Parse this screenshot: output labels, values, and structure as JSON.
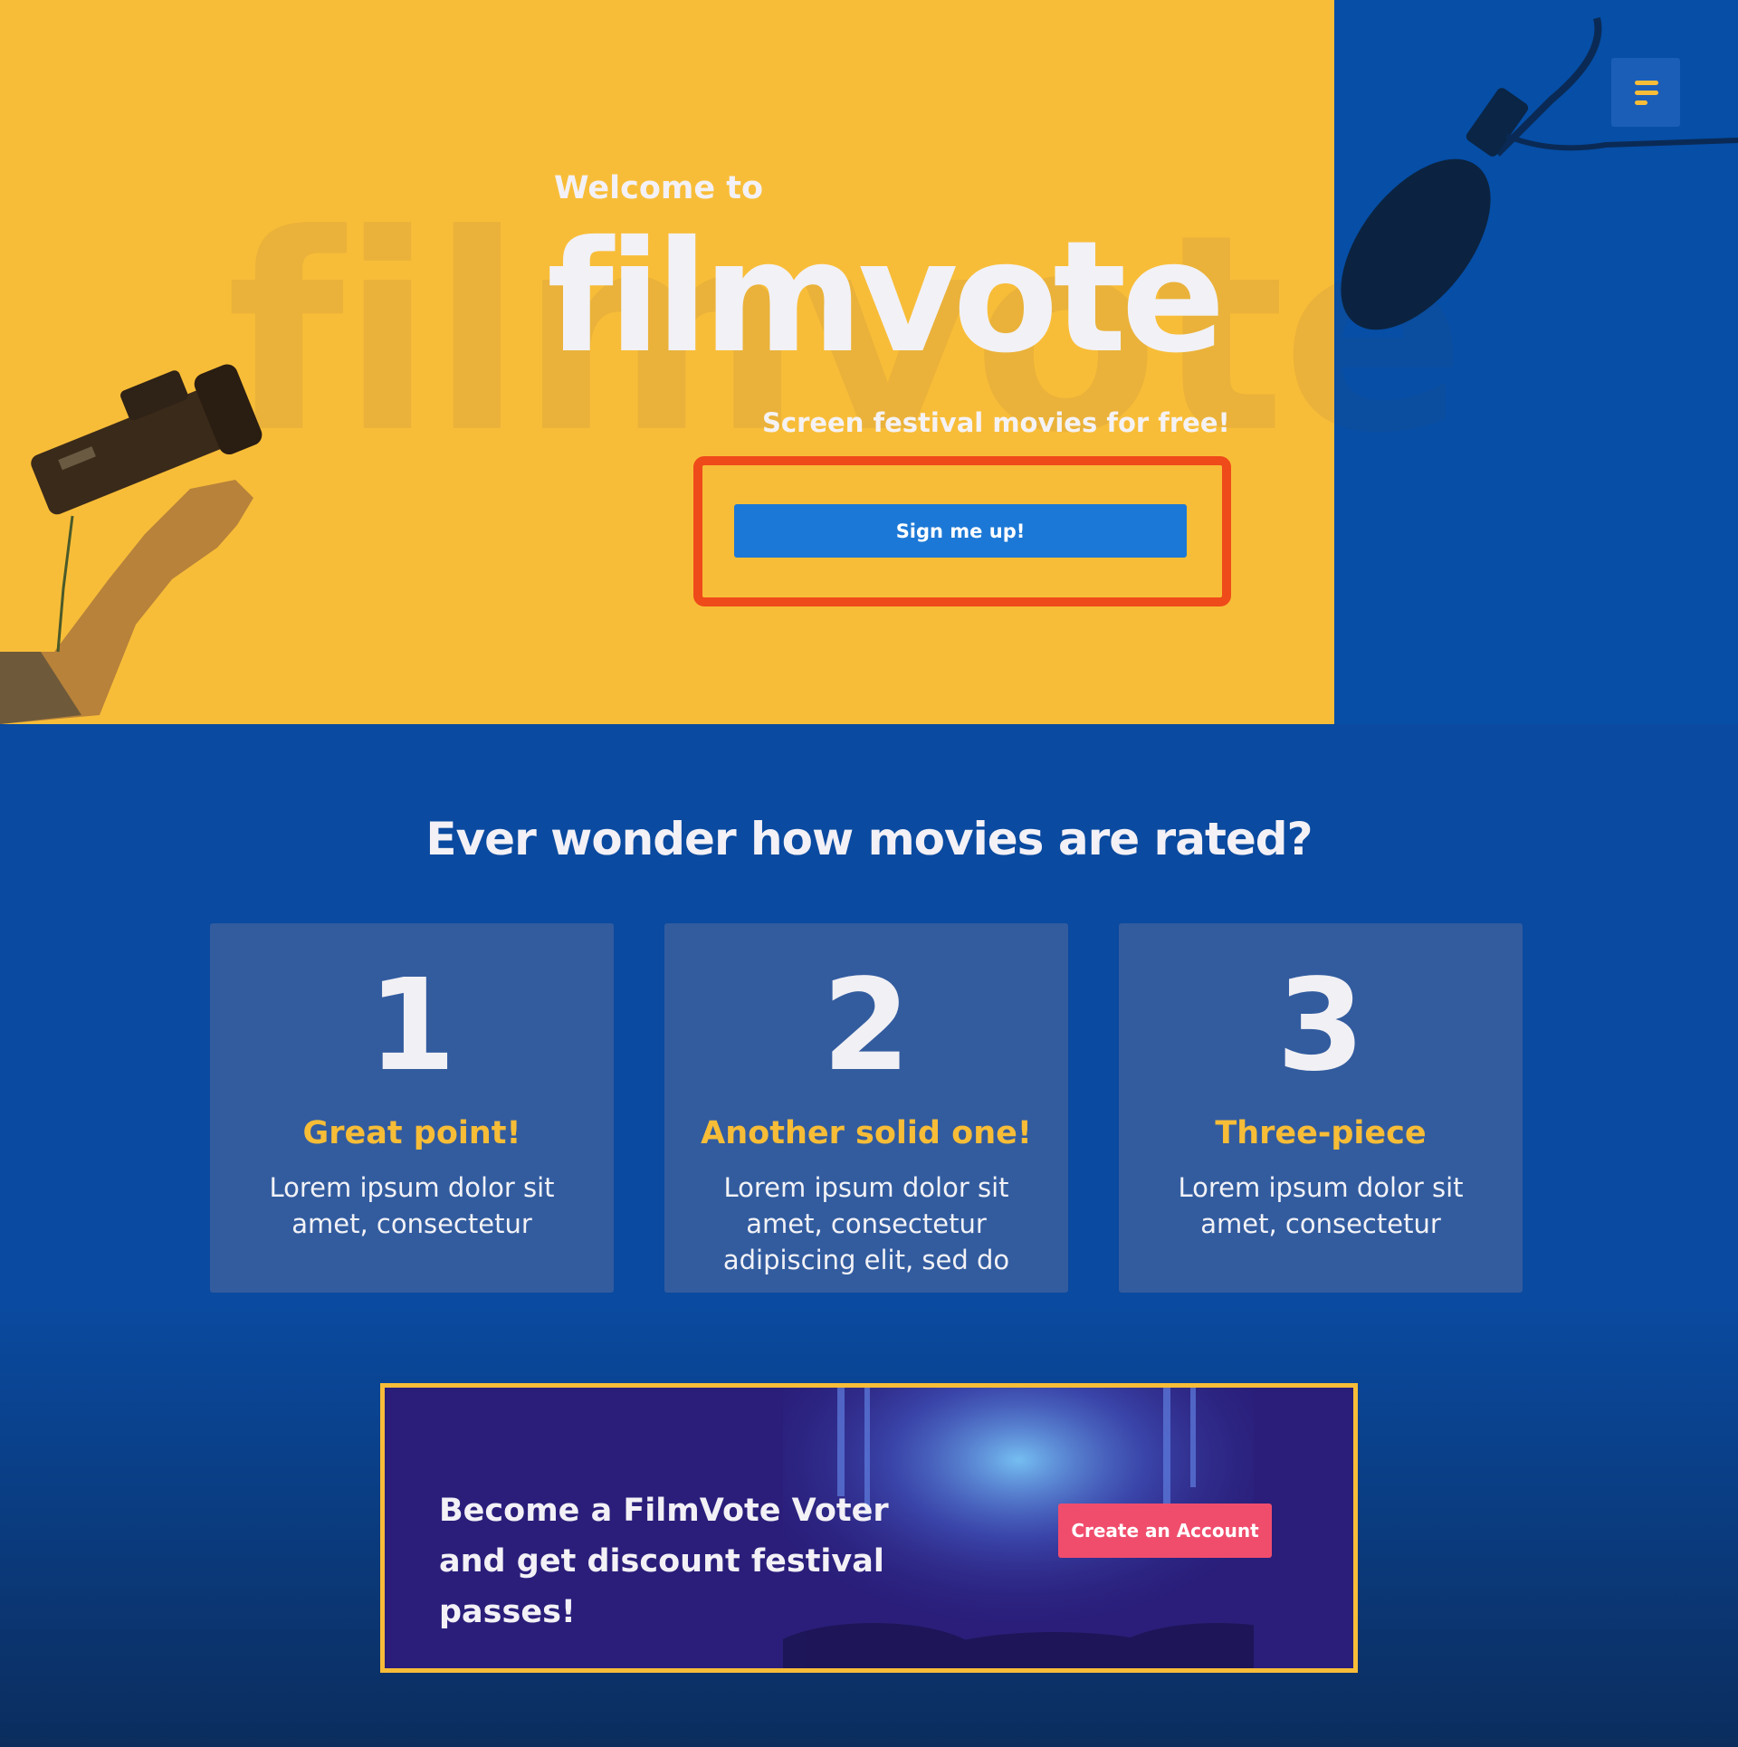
{
  "hero": {
    "welcome": "Welcome to",
    "brand": "filmvote",
    "watermark": "filmvote",
    "tagline": "Screen festival movies for free!",
    "signup_label": "Sign me up!"
  },
  "nav": {
    "menu_icon": "menu-icon"
  },
  "section": {
    "title": "Ever wonder how movies are rated?",
    "cards": [
      {
        "number": "1",
        "title": "Great point!",
        "body": "Lorem ipsum dolor sit amet, consectetur"
      },
      {
        "number": "2",
        "title": "Another solid one!",
        "body": "Lorem ipsum dolor sit amet, consectetur adipiscing elit, sed do"
      },
      {
        "number": "3",
        "title": "Three-piece",
        "body": "Lorem ipsum dolor sit amet, consectetur"
      }
    ]
  },
  "cta": {
    "text": "Become a FilmVote Voter and get discount festival passes!",
    "button_label": "Create an Account"
  },
  "colors": {
    "yellow": "#f8bd38",
    "blue": "#0a4aa0",
    "card": "#335c9f",
    "signup_button": "#1c78d6",
    "highlight_frame": "#ef4a1a",
    "cta_button": "#f04d6d"
  }
}
